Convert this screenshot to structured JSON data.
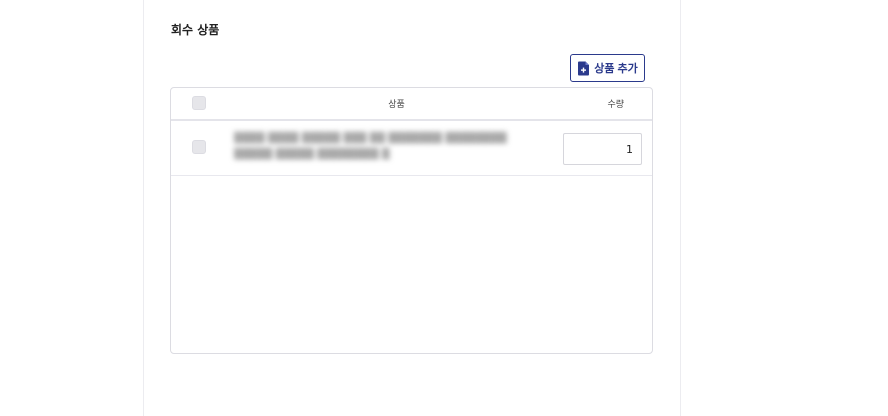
{
  "section": {
    "title": "회수 상품"
  },
  "toolbar": {
    "add_label": "상품 추가"
  },
  "table": {
    "columns": {
      "product": "상품",
      "quantity": "수량"
    },
    "rows": [
      {
        "product": "▒▒▒▒ ▒▒▒▒ ▒▒▒▒▒ ▒▒▒ ▒▒ ▒▒▒▒▒▒▒ ▒▒▒▒▒▒▒▒ ▒▒▒▒▒ ▒▒▒▒▒ ▒▒▒▒▒▒▒▒ ▒",
        "quantity": "1"
      }
    ]
  },
  "colors": {
    "accent": "#2b3a8c",
    "border": "#dcdce2",
    "checkbox": "#e6e6ea"
  },
  "icons": {
    "add": "document-add-icon"
  }
}
